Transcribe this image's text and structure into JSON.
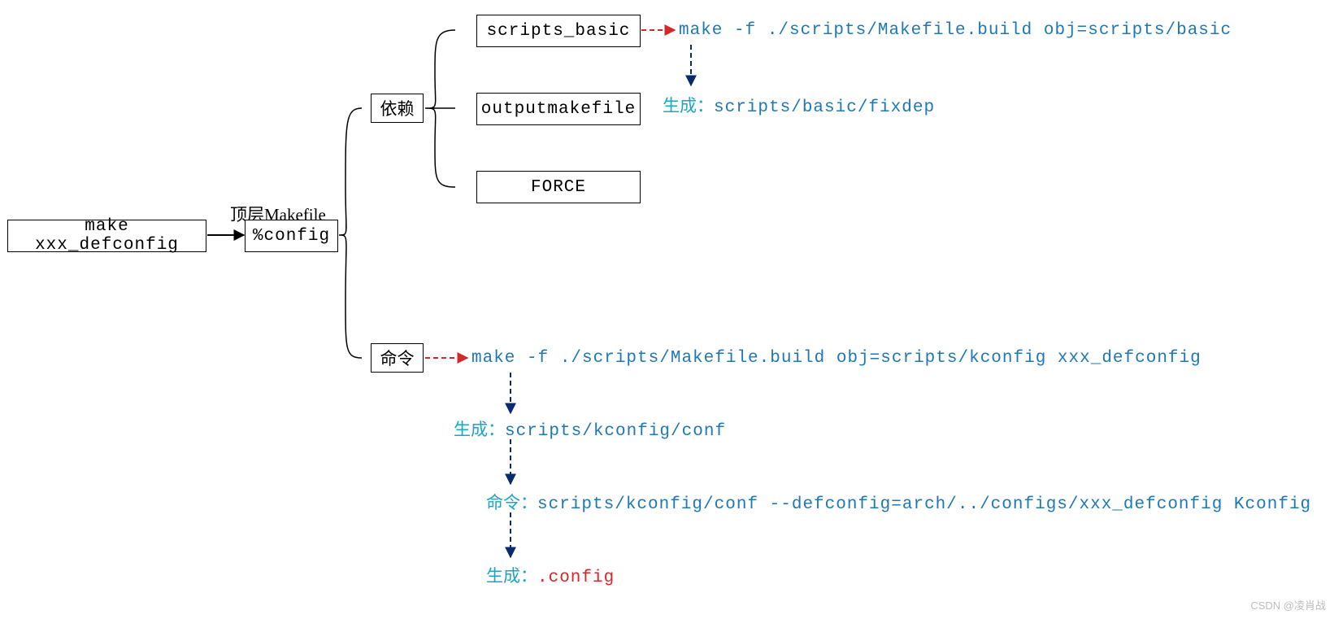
{
  "nodes": {
    "make_defconfig": "make xxx_defconfig",
    "top_makefile_label": "顶层Makefile",
    "config": "%config",
    "depend": "依赖",
    "command": "命令",
    "scripts_basic": "scripts_basic",
    "outputmakefile": "outputmakefile",
    "force": "FORCE"
  },
  "texts": {
    "make_scripts_basic": "make -f ./scripts/Makefile.build obj=scripts/basic",
    "gen_fixdep_prefix": "生成：",
    "gen_fixdep_value": "scripts/basic/fixdep",
    "make_kconfig": "make -f ./scripts/Makefile.build obj=scripts/kconfig xxx_defconfig",
    "gen_conf_prefix": "生成：",
    "gen_conf_value": "scripts/kconfig/conf",
    "cmd_conf_prefix": "命令：",
    "cmd_conf_value": "scripts/kconfig/conf --defconfig=arch/../configs/xxx_defconfig Kconfig",
    "gen_config_prefix": "生成：",
    "gen_config_value": ".config"
  },
  "watermark": "CSDN @凌肖战"
}
